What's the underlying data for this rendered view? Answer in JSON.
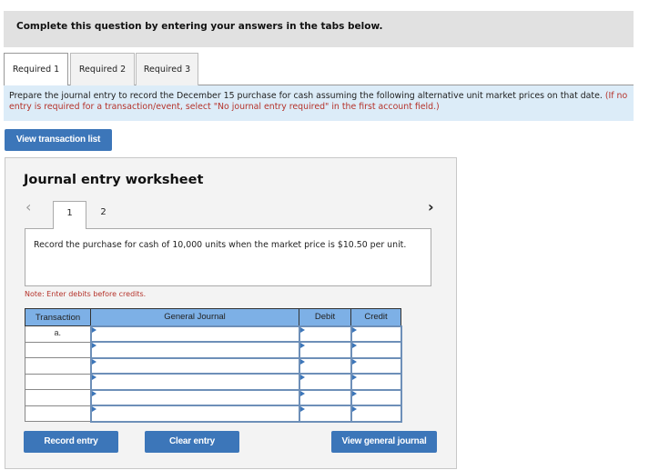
{
  "header": {
    "instruction": "Complete this question by entering your answers in the tabs below."
  },
  "tabs": [
    {
      "label": "Required 1",
      "active": true
    },
    {
      "label": "Required 2",
      "active": false
    },
    {
      "label": "Required 3",
      "active": false
    }
  ],
  "prompt": {
    "text": "Prepare the journal entry to record the December 15 purchase for cash assuming the following alternative unit market prices on that date.",
    "hint": "(If no entry is required for a transaction/event, select \"No journal entry required\" in the first account field.)"
  },
  "view_transaction_list_label": "View transaction list",
  "worksheet": {
    "title": "Journal entry worksheet",
    "prev_icon": "chevron-left-icon",
    "next_icon": "chevron-right-icon",
    "steps": [
      "1",
      "2"
    ],
    "active_step": "1",
    "description": "Record the purchase for cash of 10,000 units when the market price is $10.50 per unit.",
    "note": "Note: Enter debits before credits.",
    "table": {
      "headers": [
        "Transaction",
        "General Journal",
        "Debit",
        "Credit"
      ],
      "rows": [
        {
          "transaction": "a.",
          "account": "",
          "debit": "",
          "credit": ""
        },
        {
          "transaction": "",
          "account": "",
          "debit": "",
          "credit": ""
        },
        {
          "transaction": "",
          "account": "",
          "debit": "",
          "credit": ""
        },
        {
          "transaction": "",
          "account": "",
          "debit": "",
          "credit": ""
        },
        {
          "transaction": "",
          "account": "",
          "debit": "",
          "credit": ""
        },
        {
          "transaction": "",
          "account": "",
          "debit": "",
          "credit": ""
        }
      ]
    },
    "buttons": {
      "record": "Record entry",
      "clear": "Clear entry",
      "view_journal": "View general journal"
    }
  },
  "colors": {
    "button": "#3c76b9",
    "table_header": "#7db0e6",
    "hint_red": "#b5332b",
    "prompt_bg": "#dcecf8"
  }
}
